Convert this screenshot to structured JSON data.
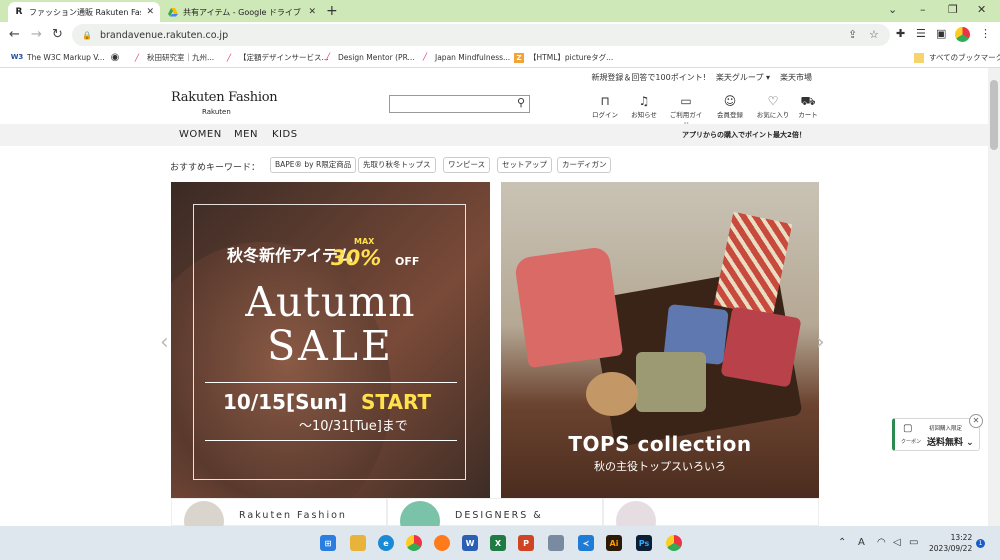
{
  "browser": {
    "tabs": [
      {
        "favicon": "R",
        "title": "ファッション通販 Rakuten Fashion(ラ",
        "active": true
      },
      {
        "favicon": "drive-icon",
        "title": "共有アイテム - Google ドライブ",
        "active": false
      }
    ],
    "new_tab": "+",
    "window_controls": [
      "⌄",
      "–",
      "❐",
      "✕"
    ],
    "url": "brandavenue.rakuten.co.jp",
    "bookmarks": [
      {
        "icon": "W3",
        "label": "The W3C Markup V..."
      },
      {
        "icon": "globe-icon",
        "label": ""
      },
      {
        "icon": "slash-icon",
        "label": "秋田研究室｜九州..."
      },
      {
        "icon": "slash-icon",
        "label": "【定額デザインサービス..."
      },
      {
        "icon": "slash-icon",
        "label": "Design Mentor (PR..."
      },
      {
        "icon": "slash-icon",
        "label": "Japan Mindfulness..."
      },
      {
        "icon": "Z",
        "label": "【HTML】pictureタグ..."
      }
    ],
    "all_bookmarks": "すべてのブックマーク"
  },
  "site": {
    "util_links": [
      "新規登録＆回答で100ポイント!",
      "楽天グループ ▾",
      "楽天市場"
    ],
    "logo": "Rakuten Fashion",
    "logo_sub": "Rakuten",
    "header_icons": [
      {
        "icon": "lock-icon",
        "label": "ログイン"
      },
      {
        "icon": "bell-icon",
        "label": "お知らせ"
      },
      {
        "icon": "book-icon",
        "label": "ご利用ガイド"
      },
      {
        "icon": "user-icon",
        "label": "会員登録"
      },
      {
        "icon": "heart-icon",
        "label": "お気に入り"
      },
      {
        "icon": "cart-icon",
        "label": "カート"
      }
    ],
    "categories": [
      "WOMEN",
      "MEN",
      "KIDS"
    ],
    "promo": "アプリからの購入でポイント最大2倍！",
    "keyword_label": "おすすめキーワード：",
    "keywords": [
      "BAPE® by R限定商品",
      "先取り秋冬トップス",
      "ワンピース",
      "セットアップ",
      "カーディガン"
    ],
    "banner1": {
      "pre": "秋冬新作アイテム",
      "max": "MAX",
      "pct": "30%",
      "off": "OFF",
      "line1": "Autumn",
      "line2": "SALE",
      "date": "10/15[Sun]",
      "start": "START",
      "end": "〜10/31[Tue]まで"
    },
    "banner2": {
      "title": "TOPS collection",
      "subtitle": "秋の主役トップスいろいろ"
    },
    "cards": [
      "Rakuten Fashion",
      "DESIGNERS &"
    ],
    "coupon": {
      "label": "クーポン",
      "line1": "初回購入限定",
      "line2": "送料無料 ⌄"
    }
  },
  "taskbar": {
    "clock_time": "13:22",
    "clock_date": "2023/09/22",
    "ime": "A",
    "notifications": "1"
  },
  "colors": {
    "tabbar": "#cfe8b8",
    "accent_yellow": "#ffe14d",
    "coupon_green": "#2c8a4e"
  }
}
